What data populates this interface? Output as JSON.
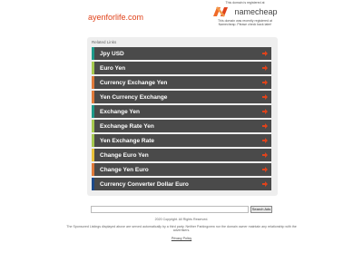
{
  "header": {
    "domain": "ayenforlife.com"
  },
  "registrar": {
    "note_top": "This domain is registered at",
    "logo_text": "namecheap",
    "note_bottom": "This domain was recently registered at Namecheap. Please check back later!"
  },
  "related": {
    "title": "Related Links",
    "links": [
      {
        "label": "Jpy USD",
        "accent": "#1d9a8a"
      },
      {
        "label": "Euro Yen",
        "accent": "#a6c94f"
      },
      {
        "label": "Currency Exchange Yen",
        "accent": "#e07a3a"
      },
      {
        "label": "Yen Currency Exchange",
        "accent": "#e07a3a"
      },
      {
        "label": "Exchange Yen",
        "accent": "#1d9a8a"
      },
      {
        "label": "Exchange Rate Yen",
        "accent": "#a6c94f"
      },
      {
        "label": "Yen Exchange Rate",
        "accent": "#a6c94f"
      },
      {
        "label": "Change Euro Yen",
        "accent": "#e8c23a"
      },
      {
        "label": "Change Yen Euro",
        "accent": "#e07a3a"
      },
      {
        "label": "Currency Converter Dollar Euro",
        "accent": "#1d4a8a"
      }
    ]
  },
  "search": {
    "placeholder": "",
    "button_label": "Search Ads"
  },
  "footer": {
    "copyright": "2020 Copyright. All Rights Reserved.",
    "disclaimer": "The Sponsored Listings displayed above are served automatically by a third party. Neither Parkingcrew nor the domain owner maintain any relationship with the advertisers.",
    "privacy": "Privacy Policy"
  },
  "colors": {
    "arrow": "#e0431b",
    "link_bg": "#4a4a4a",
    "brand_orange": "#e0431b"
  }
}
